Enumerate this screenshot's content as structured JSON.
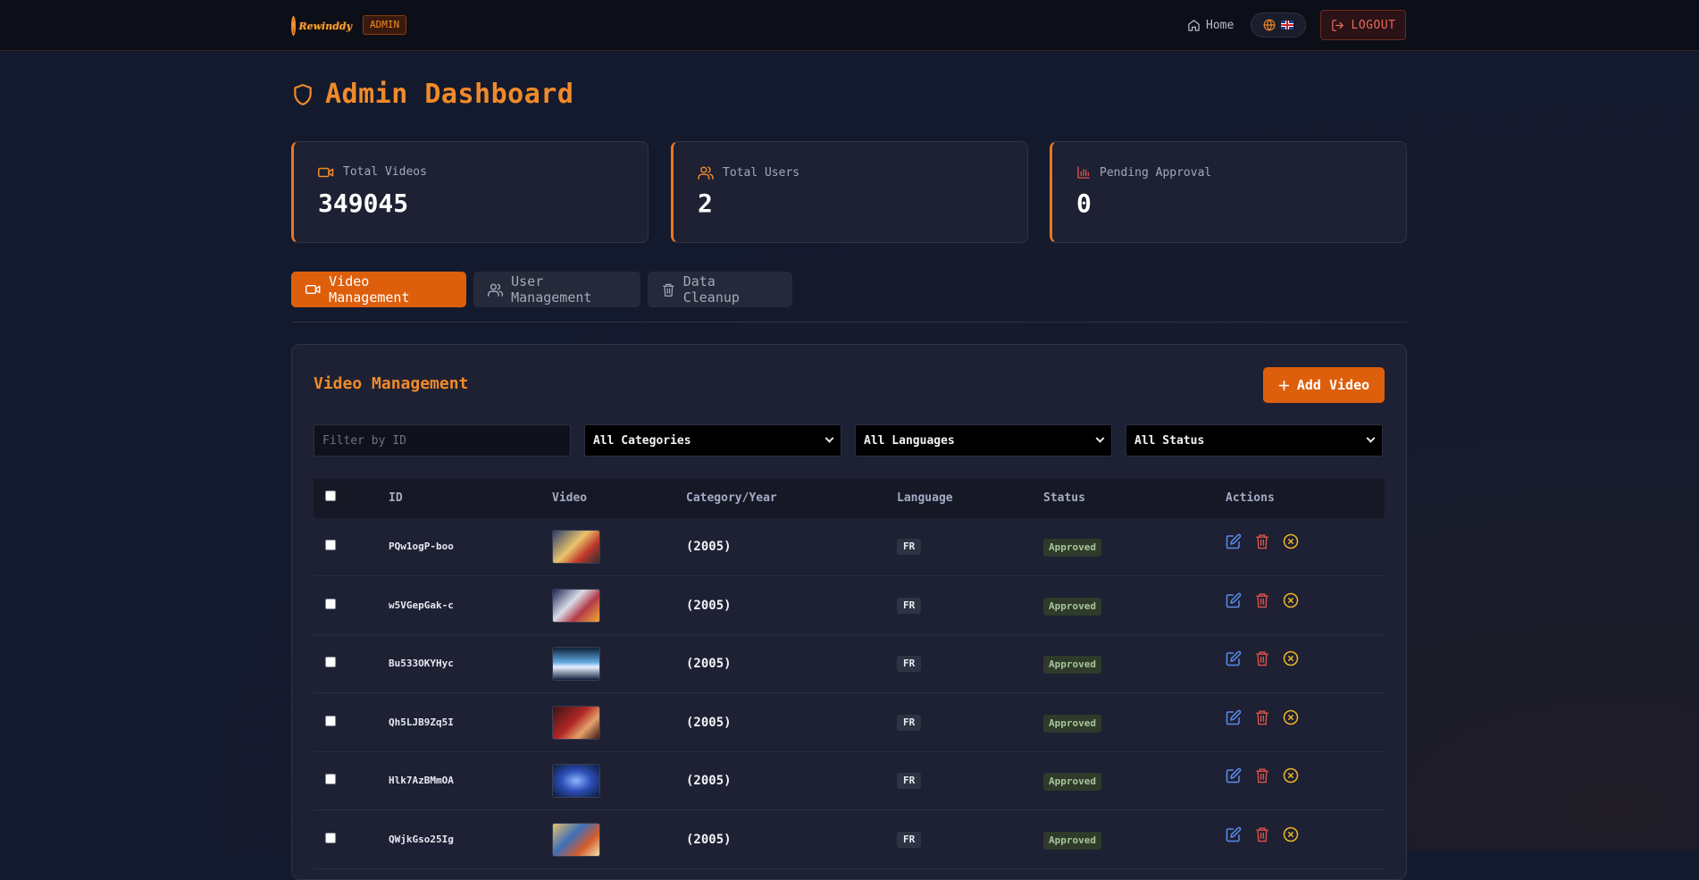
{
  "header": {
    "logo_text": "Rewinddy",
    "admin_badge": "ADMIN",
    "home_label": "Home",
    "logout_label": "LOGOUT"
  },
  "page": {
    "title": "Admin Dashboard"
  },
  "stats": [
    {
      "label": "Total Videos",
      "value": "349045",
      "icon": "video-icon"
    },
    {
      "label": "Total Users",
      "value": "2",
      "icon": "users-icon"
    },
    {
      "label": "Pending Approval",
      "value": "0",
      "icon": "bar-chart-icon"
    }
  ],
  "tabs": [
    {
      "label": "Video Management",
      "icon": "video-icon",
      "active": true
    },
    {
      "label": "User Management",
      "icon": "users-icon",
      "active": false
    },
    {
      "label": "Data Cleanup",
      "icon": "trash-icon",
      "active": false
    }
  ],
  "panel": {
    "title": "Video Management",
    "add_button": "Add Video"
  },
  "filters": {
    "id_placeholder": "Filter by ID",
    "category": "All Categories",
    "language": "All Languages",
    "status": "All Status"
  },
  "table": {
    "headers": [
      "ID",
      "Video",
      "Category/Year",
      "Language",
      "Status",
      "Actions"
    ],
    "rows": [
      {
        "id": "PQw1ogP-boo",
        "year": "(2005)",
        "lang": "FR",
        "status": "Approved"
      },
      {
        "id": "w5VGepGak-c",
        "year": "(2005)",
        "lang": "FR",
        "status": "Approved"
      },
      {
        "id": "Bu533OKYHyc",
        "year": "(2005)",
        "lang": "FR",
        "status": "Approved"
      },
      {
        "id": "Qh5LJB9Zq5I",
        "year": "(2005)",
        "lang": "FR",
        "status": "Approved"
      },
      {
        "id": "Hlk7AzBMmOA",
        "year": "(2005)",
        "lang": "FR",
        "status": "Approved"
      },
      {
        "id": "QWjkGso25Ig",
        "year": "(2005)",
        "lang": "FR",
        "status": "Approved"
      }
    ]
  },
  "colors": {
    "accent": "#dd5f0c",
    "accent_text": "#f08a2a",
    "background": "#141a2e",
    "card": "#1d2133",
    "edit_icon": "#5b8cf0",
    "delete_icon": "#e0524a",
    "reject_icon": "#f0b429"
  }
}
